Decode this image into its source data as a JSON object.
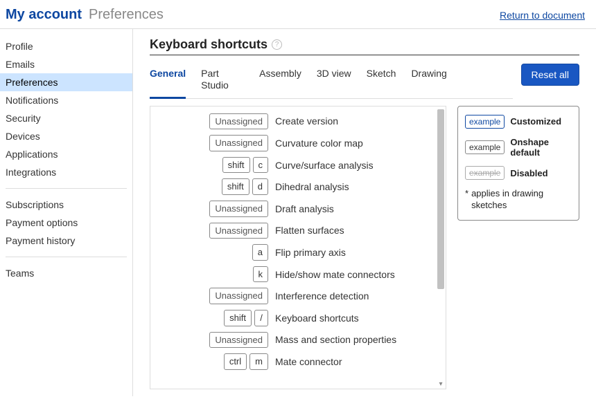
{
  "header": {
    "my_account": "My account",
    "crumb": "Preferences",
    "return_link": "Return to document"
  },
  "sidebar": {
    "group1": [
      "Profile",
      "Emails",
      "Preferences",
      "Notifications",
      "Security",
      "Devices",
      "Applications",
      "Integrations"
    ],
    "group2": [
      "Subscriptions",
      "Payment options",
      "Payment history"
    ],
    "group3": [
      "Teams"
    ],
    "active": "Preferences"
  },
  "section": {
    "title": "Keyboard shortcuts"
  },
  "tabs": {
    "items": [
      "General",
      "Part Studio",
      "Assembly",
      "3D view",
      "Sketch",
      "Drawing"
    ],
    "active": "General"
  },
  "reset_label": "Reset all",
  "shortcuts": [
    {
      "keys": [
        "Unassigned"
      ],
      "unassigned": true,
      "action": "Create version"
    },
    {
      "keys": [
        "Unassigned"
      ],
      "unassigned": true,
      "action": "Curvature color map"
    },
    {
      "keys": [
        "shift",
        "c"
      ],
      "action": "Curve/surface analysis"
    },
    {
      "keys": [
        "shift",
        "d"
      ],
      "action": "Dihedral analysis"
    },
    {
      "keys": [
        "Unassigned"
      ],
      "unassigned": true,
      "action": "Draft analysis"
    },
    {
      "keys": [
        "Unassigned"
      ],
      "unassigned": true,
      "action": "Flatten surfaces"
    },
    {
      "keys": [
        "a"
      ],
      "action": "Flip primary axis"
    },
    {
      "keys": [
        "k"
      ],
      "action": "Hide/show mate connectors"
    },
    {
      "keys": [
        "Unassigned"
      ],
      "unassigned": true,
      "action": "Interference detection"
    },
    {
      "keys": [
        "shift",
        "/"
      ],
      "action": "Keyboard shortcuts"
    },
    {
      "keys": [
        "Unassigned"
      ],
      "unassigned": true,
      "action": "Mass and section properties"
    },
    {
      "keys": [
        "ctrl",
        "m"
      ],
      "action": "Mate connector"
    }
  ],
  "legend": {
    "example": "example",
    "customized": "Customized",
    "default": "Onshape default",
    "disabled": "Disabled",
    "note_marker": "*",
    "note": "applies in drawing sketches"
  }
}
